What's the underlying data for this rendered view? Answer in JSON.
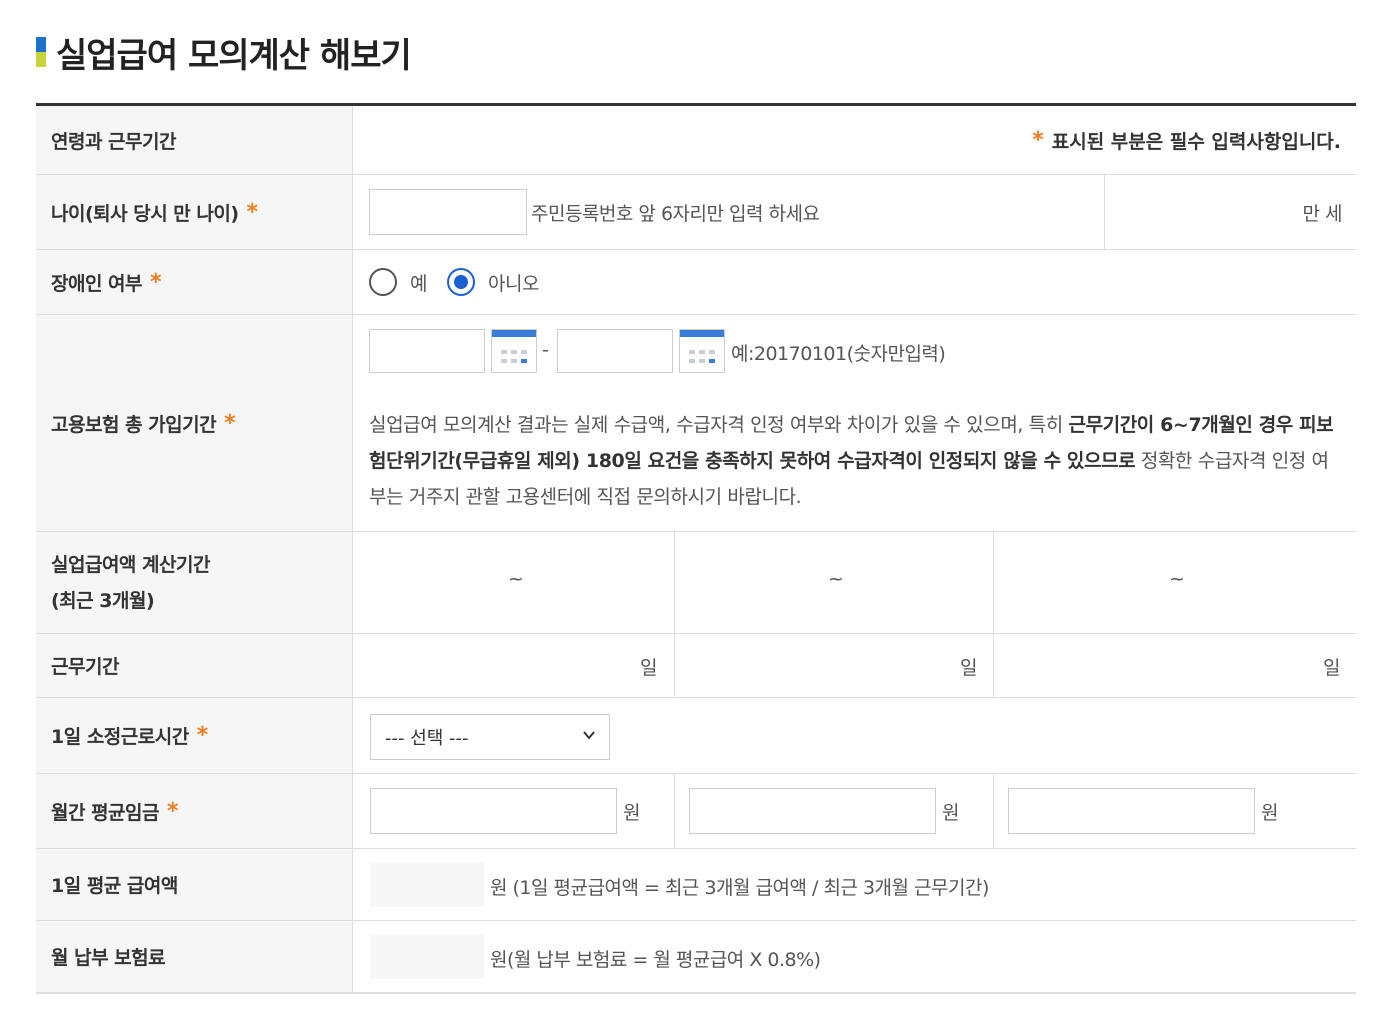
{
  "title": "실업급여 모의계산 해보기",
  "header": {
    "label": "연령과 근무기간",
    "required_mark": "*",
    "required_note": "표시된 부분은 필수 입력사항입니다."
  },
  "age": {
    "label": "나이(퇴사 당시 만 나이)",
    "value": "",
    "hint": "주민등록번호 앞 6자리만 입력 하세요",
    "result_unit": "만 세"
  },
  "disability": {
    "label": "장애인 여부",
    "options": [
      "예",
      "아니오"
    ],
    "selected": "아니오"
  },
  "insurance_period": {
    "label": "고용보험 총 가입기간",
    "start": "",
    "end": "",
    "separator": "-",
    "example": "예:20170101(숫자만입력)",
    "notice_1": "실업급여 모의계산 결과는 실제 수급액, 수급자격 인정 여부와 차이가 있을 수 있으며, 특히 ",
    "notice_bold": "근무기간이 6~7개월인 경우 피보험단위기간(무급휴일 제외) 180일 요건을 충족하지 못하여 수급자격이 인정되지 않을 수 있으므로",
    "notice_2": " 정확한 수급자격 인정 여부는 거주지 관할 고용센터에 직접 문의하시기 바랍니다."
  },
  "calc_period": {
    "label_line1": "실업급여액 계산기간",
    "label_line2": "(최근 3개월)",
    "cells": [
      "~",
      "~",
      "~"
    ]
  },
  "work_days": {
    "label": "근무기간",
    "unit": "일"
  },
  "daily_hours": {
    "label": "1일 소정근로시간",
    "selected": "--- 선택 ---"
  },
  "monthly_wage": {
    "label": "월간 평균임금",
    "unit": "원",
    "values": [
      "",
      "",
      ""
    ]
  },
  "daily_benefit": {
    "label": "1일 평균 급여액",
    "note": "원 (1일 평균급여액 = 최근 3개월 급여액 / 최근 3개월 근무기간)"
  },
  "monthly_premium": {
    "label": "월 납부 보험료",
    "note": "원(월 납부 보험료 = 월 평균급여 X 0.8%)"
  },
  "colors": {
    "accent": "#f07c1e",
    "radio_selected": "#1a5fd6",
    "title_bar_top": "#1a73c9",
    "title_bar_bottom": "#c8d43a"
  }
}
